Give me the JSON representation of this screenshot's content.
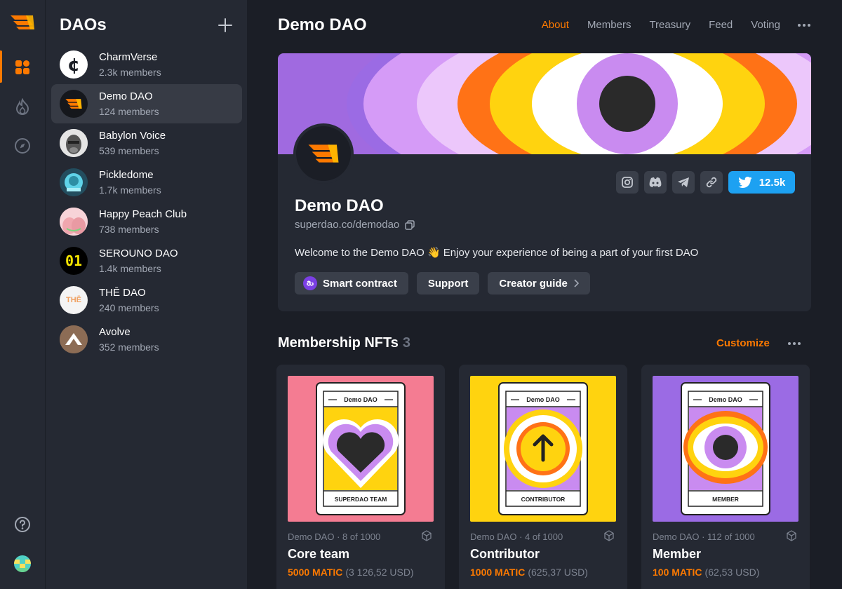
{
  "colors": {
    "accent": "#fc7900",
    "twitter": "#1da1f2",
    "panel": "#252933",
    "bg": "#1b1e26"
  },
  "rail": {
    "icons": [
      "superdao-logo",
      "grid-icon",
      "fire-icon",
      "compass-icon",
      "help-icon",
      "user-avatar"
    ]
  },
  "dao_list": {
    "title": "DAOs",
    "items": [
      {
        "name": "CharmVerse",
        "members": "2.3k members"
      },
      {
        "name": "Demo DAO",
        "members": "124 members",
        "selected": true
      },
      {
        "name": "Babylon Voice",
        "members": "539 members"
      },
      {
        "name": "Pickledome",
        "members": "1.7k members"
      },
      {
        "name": "Happy Peach Club",
        "members": "738 members"
      },
      {
        "name": "SEROUNO DAO",
        "members": "1.4k members",
        "avatar_text": "01"
      },
      {
        "name": "THĒ DAO",
        "members": "240 members",
        "avatar_text": "THĒ"
      },
      {
        "name": "Avolve",
        "members": "352 members"
      }
    ]
  },
  "header": {
    "title": "Demo DAO",
    "tabs": [
      "About",
      "Members",
      "Treasury",
      "Feed",
      "Voting"
    ],
    "active_tab": "About"
  },
  "profile": {
    "name": "Demo DAO",
    "url": "superdao.co/demodao",
    "description": "Welcome to the Demo DAO 👋 Enjoy your experience of being a part of your first DAO",
    "twitter_count": "12.5k",
    "socials": [
      "instagram-icon",
      "discord-icon",
      "telegram-icon",
      "link-icon"
    ],
    "buttons": [
      "Smart contract",
      "Support",
      "Creator guide"
    ]
  },
  "nfts": {
    "title": "Membership NFTs",
    "count": "3",
    "customize": "Customize",
    "items": [
      {
        "meta": "Demo DAO · 8 of 1000",
        "name": "Core team",
        "price": "5000 MATIC",
        "usd": "(3 126,52 USD)",
        "card_header": "Demo DAO",
        "card_footer": "SUPERDAO TEAM",
        "bg": "#f47c92"
      },
      {
        "meta": "Demo DAO · 4 of 1000",
        "name": "Contributor",
        "price": "1000 MATIC",
        "usd": "(625,37 USD)",
        "card_header": "Demo DAO",
        "card_footer": "CONTRIBUTOR",
        "bg": "#ffd30f"
      },
      {
        "meta": "Demo DAO · 112 of 1000",
        "name": "Member",
        "price": "100 MATIC",
        "usd": "(62,53 USD)",
        "card_header": "Demo DAO",
        "card_footer": "MEMBER",
        "bg": "#9b6be4"
      }
    ]
  }
}
